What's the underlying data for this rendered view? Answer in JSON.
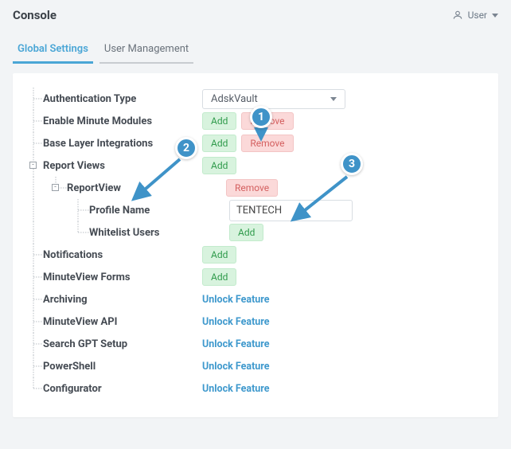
{
  "header": {
    "title": "Console"
  },
  "user": {
    "label": "User"
  },
  "tabs": {
    "global": "Global Settings",
    "users": "User Management"
  },
  "rows": {
    "auth_type": {
      "label": "Authentication Type",
      "value": "AdskVault"
    },
    "minute_modules": {
      "label": "Enable Minute Modules"
    },
    "base_layer": {
      "label": "Base Layer Integrations"
    },
    "report_views": {
      "label": "Report Views"
    },
    "report_view": {
      "label": "ReportView"
    },
    "profile_name": {
      "label": "Profile Name",
      "value": "TENTECH"
    },
    "whitelist": {
      "label": "Whitelist Users"
    },
    "notifications": {
      "label": "Notifications"
    },
    "mv_forms": {
      "label": "MinuteView Forms"
    },
    "archiving": {
      "label": "Archiving"
    },
    "mv_api": {
      "label": "MinuteView API"
    },
    "gpt": {
      "label": "Search GPT Setup"
    },
    "powershell": {
      "label": "PowerShell"
    },
    "configurator": {
      "label": "Configurator"
    }
  },
  "buttons": {
    "add": "Add",
    "remove": "Remove",
    "unlock": "Unlock Feature"
  },
  "callouts": {
    "one": "1",
    "two": "2",
    "three": "3"
  }
}
